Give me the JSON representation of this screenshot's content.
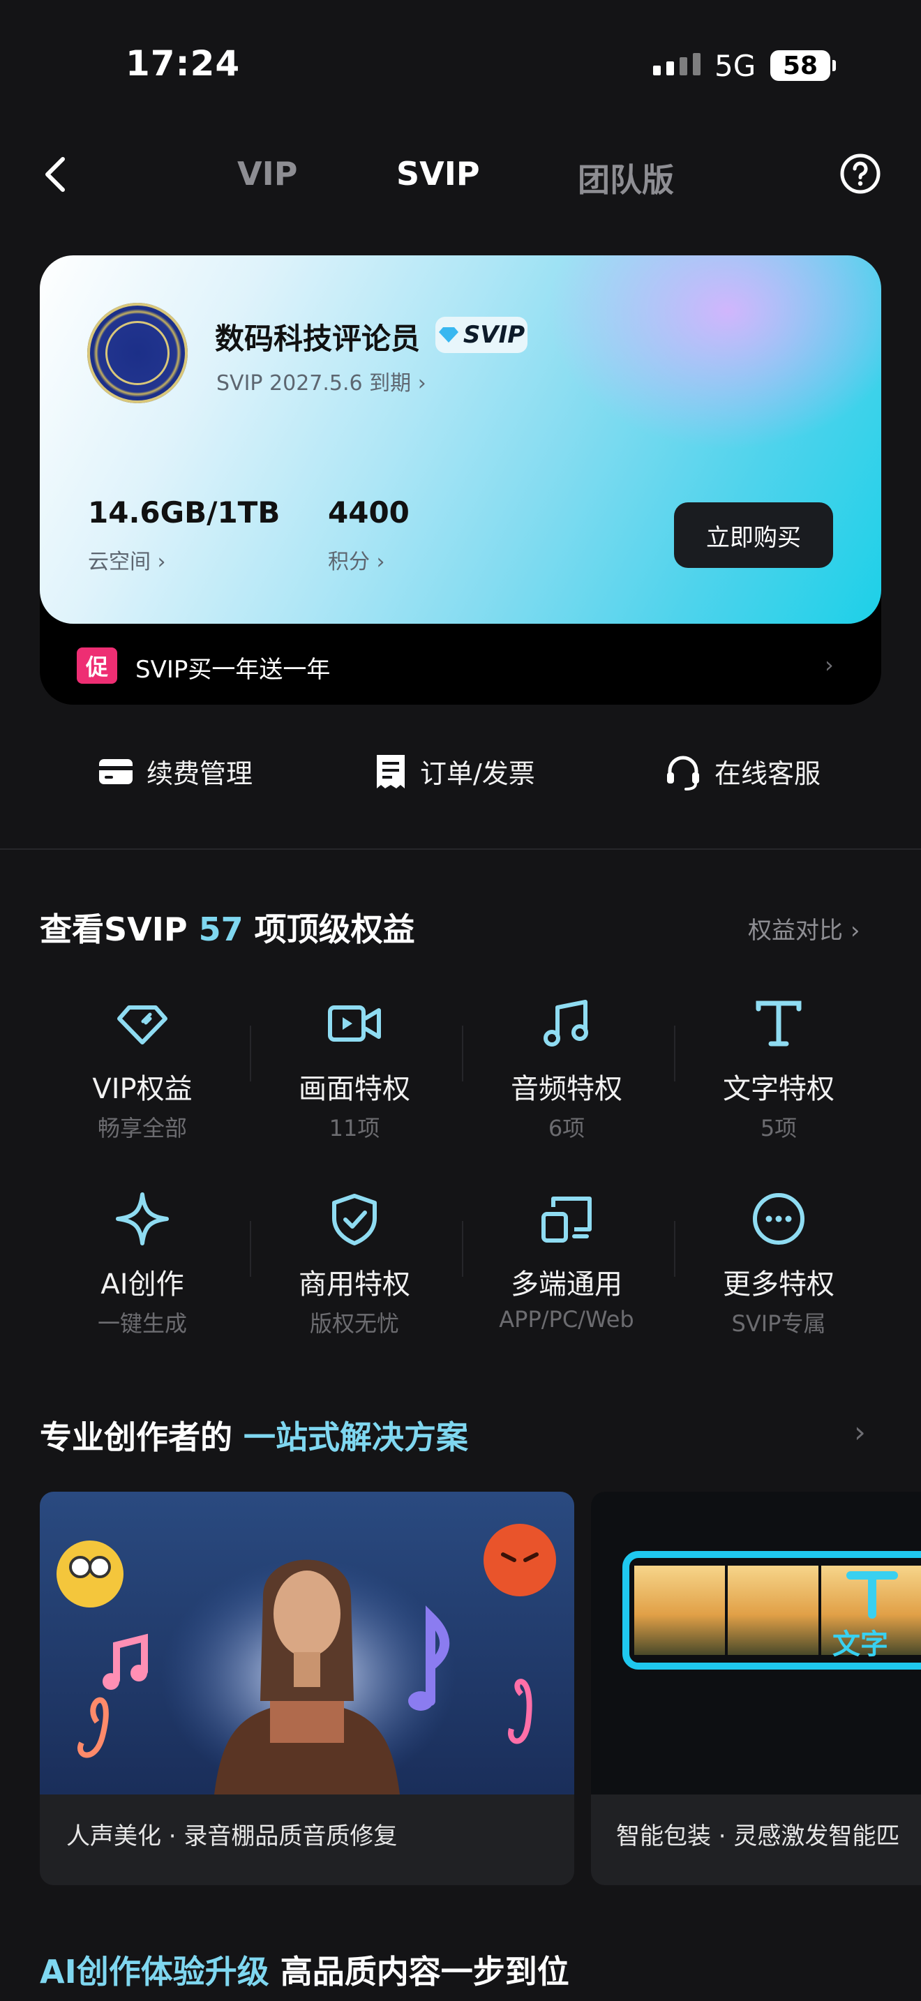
{
  "status_bar": {
    "time": "17:24",
    "network": "5G",
    "battery": "58"
  },
  "nav": {
    "tabs": [
      {
        "label": "VIP",
        "active": false
      },
      {
        "label": "SVIP",
        "active": true
      },
      {
        "label": "团队版",
        "active": false
      }
    ]
  },
  "member_card": {
    "username": "数码科技评论员",
    "badge": "SVIP",
    "expiry": "SVIP 2027.5.6 到期",
    "stats": [
      {
        "value": "14.6GB/1TB",
        "label": "云空间"
      },
      {
        "value": "4400",
        "label": "积分"
      }
    ],
    "buy_button": "立即购买",
    "promo": {
      "tag": "促",
      "text": "SVIP买一年送一年"
    }
  },
  "quick_actions": [
    {
      "label": "续费管理",
      "icon": "card-icon"
    },
    {
      "label": "订单/发票",
      "icon": "receipt-icon"
    },
    {
      "label": "在线客服",
      "icon": "headset-icon"
    }
  ],
  "benefits_section": {
    "title_prefix": "查看SVIP",
    "count": "57",
    "title_suffix": "项顶级权益",
    "compare_link": "权益对比",
    "items": [
      {
        "title": "VIP权益",
        "subtitle": "畅享全部",
        "icon": "diamond-icon"
      },
      {
        "title": "画面特权",
        "subtitle": "11项",
        "icon": "video-icon"
      },
      {
        "title": "音频特权",
        "subtitle": "6项",
        "icon": "music-note-icon"
      },
      {
        "title": "文字特权",
        "subtitle": "5项",
        "icon": "text-icon"
      },
      {
        "title": "AI创作",
        "subtitle": "一键生成",
        "icon": "sparkle-icon"
      },
      {
        "title": "商用特权",
        "subtitle": "版权无忧",
        "icon": "shield-check-icon"
      },
      {
        "title": "多端通用",
        "subtitle": "APP/PC/Web",
        "icon": "devices-icon"
      },
      {
        "title": "更多特权",
        "subtitle": "SVIP专属",
        "icon": "more-icon"
      }
    ]
  },
  "solutions_section": {
    "title_prefix": "专业创作者的",
    "title_accent": "一站式解决方案",
    "cards": [
      {
        "caption": "人声美化 · 录音棚品质音质修复"
      },
      {
        "caption": "智能包装 · 灵感激发智能匹",
        "overlay_text": "文字"
      }
    ]
  },
  "ai_section": {
    "title_accent": "AI创作体验升级",
    "title_rest": "高品质内容一步到位"
  },
  "colors": {
    "accent": "#7fd7f0",
    "promo_tag": "#ee2e73",
    "background": "#141416"
  }
}
